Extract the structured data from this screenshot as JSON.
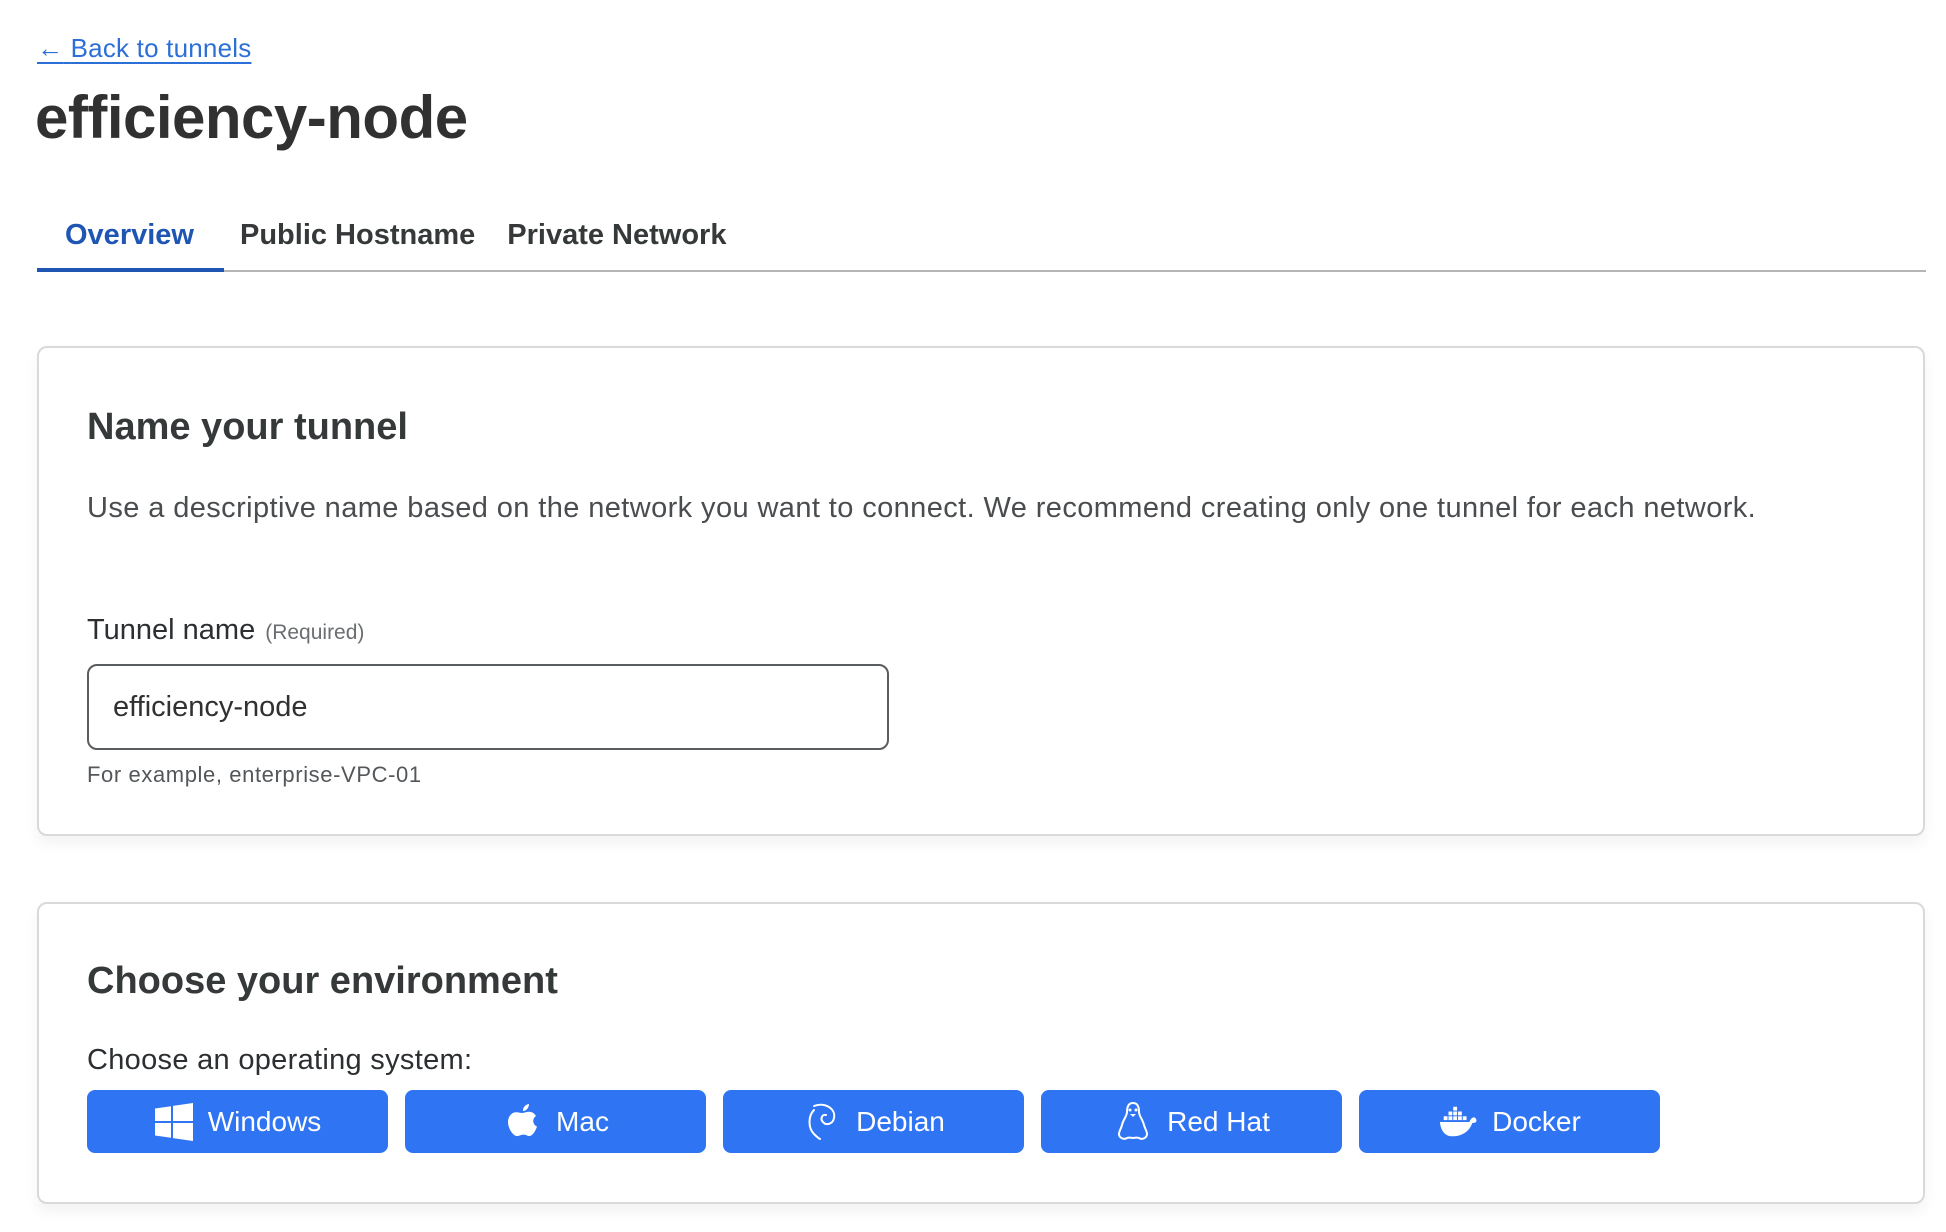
{
  "back_link": {
    "arrow": "←",
    "label": "Back to tunnels"
  },
  "page_title": "efficiency-node",
  "tabs": [
    {
      "label": "Overview",
      "active": true
    },
    {
      "label": "Public Hostname",
      "active": false
    },
    {
      "label": "Private Network",
      "active": false
    }
  ],
  "name_card": {
    "title": "Name your tunnel",
    "description": "Use a descriptive name based on the network you want to connect. We recommend creating only one tunnel for each network.",
    "field_label": "Tunnel name",
    "field_required": "(Required)",
    "field_value": "efficiency-node",
    "helper_text": "For example, enterprise-VPC-01"
  },
  "environment_card": {
    "title": "Choose your environment",
    "os_label": "Choose an operating system:",
    "os_options": [
      {
        "label": "Windows",
        "icon": "windows-icon"
      },
      {
        "label": "Mac",
        "icon": "apple-icon"
      },
      {
        "label": "Debian",
        "icon": "debian-icon"
      },
      {
        "label": "Red Hat",
        "icon": "linux-penguin-icon"
      },
      {
        "label": "Docker",
        "icon": "docker-icon"
      }
    ]
  },
  "colors": {
    "accent": "#1f55b3",
    "link": "#2c6fd6",
    "button": "#2f74f3"
  }
}
